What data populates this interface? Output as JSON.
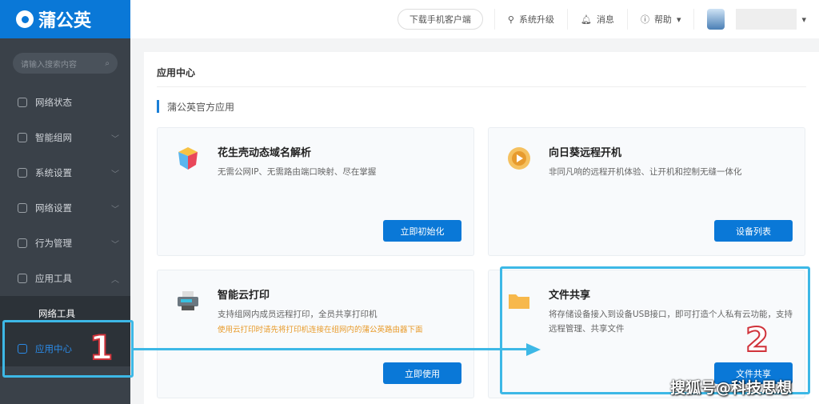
{
  "brand": "蒲公英",
  "header": {
    "download": "下载手机客户端",
    "upgrade": "系统升级",
    "messages": "消息",
    "help": "帮助"
  },
  "sidebar": {
    "search_placeholder": "请输入搜索内容",
    "items": [
      {
        "label": "网络状态"
      },
      {
        "label": "智能组网"
      },
      {
        "label": "系统设置"
      },
      {
        "label": "网络设置"
      },
      {
        "label": "行为管理"
      },
      {
        "label": "应用工具"
      }
    ],
    "sub_items": [
      {
        "label": "网络工具"
      },
      {
        "label": "应用中心"
      }
    ]
  },
  "main": {
    "title": "应用中心",
    "section": "蒲公英官方应用",
    "cards": [
      {
        "title": "花生壳动态域名解析",
        "desc": "无需公网IP、无需路由端口映射、尽在掌握",
        "button": "立即初始化"
      },
      {
        "title": "向日葵远程开机",
        "desc": "非同凡响的远程开机体验、让开机和控制无缝一体化",
        "button": "设备列表"
      },
      {
        "title": "智能云打印",
        "desc": "支持组网内成员远程打印，全员共享打印机",
        "warn": "使用云打印时请先将打印机连接在组网内的蒲公英路由器下面",
        "button": "立即使用"
      },
      {
        "title": "文件共享",
        "desc": "将存储设备接入到设备USB接口，即可打造个人私有云功能，支持远程管理、共享文件",
        "button": "文件共享"
      }
    ]
  },
  "annotations": {
    "step1": "1",
    "step2": "2",
    "watermark": "搜狐号@科技思想"
  },
  "colors": {
    "brand": "#0a78d7",
    "sidebar": "#3a4149",
    "annotation": "#3db8e6"
  }
}
